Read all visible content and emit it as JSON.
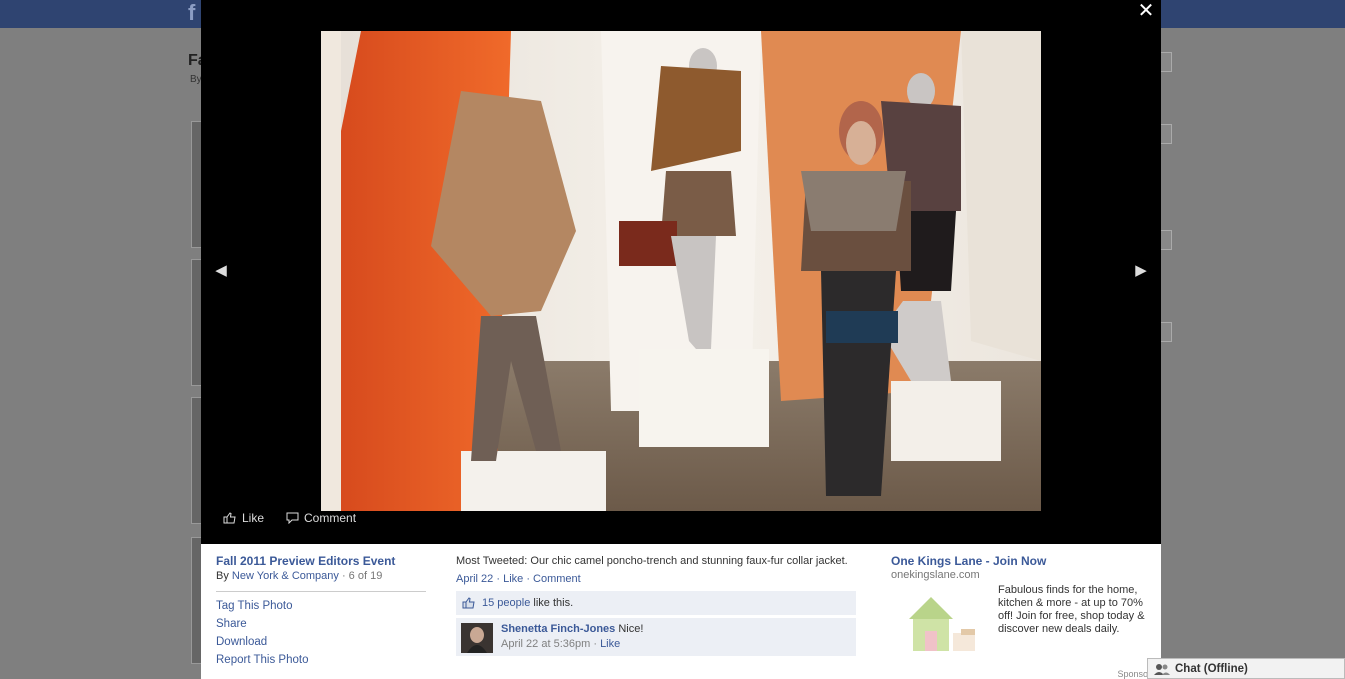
{
  "header": {
    "logo": "f"
  },
  "background": {
    "title": "Fa",
    "byline": "By"
  },
  "viewer": {
    "close_glyph": "✕",
    "prev_glyph": "◀",
    "next_glyph": "▶",
    "actions": {
      "like": "Like",
      "comment": "Comment"
    }
  },
  "info": {
    "album_title": "Fall 2011 Preview Editors Event",
    "by_label": "By",
    "owner": "New York & Company",
    "position": " · 6 of 19",
    "menu": [
      "Tag This Photo",
      "Share",
      "Download",
      "Report This Photo"
    ]
  },
  "caption": {
    "text": "Most Tweeted: Our chic camel poncho-trench and stunning faux-fur collar jacket.",
    "date": "April 22",
    "like": "Like",
    "comment": "Comment",
    "likes_count": "15 people",
    "likes_suffix": "like this."
  },
  "comment": {
    "author": "Shenetta Finch-Jones",
    "text": "Nice!",
    "meta": "April 22 at 5:36pm",
    "like": "Like"
  },
  "ad": {
    "title": "One Kings Lane - Join Now",
    "url": "onekingslane.com",
    "body": "Fabulous finds for the home, kitchen & more - at up to 70% off! Join for free, shop today & discover new deals daily.",
    "sponsored": "Sponsored"
  },
  "chat": {
    "label": "Chat (Offline)"
  },
  "colors": {
    "link": "#3b5998",
    "topbar": "#2f4471",
    "like_bg": "#eceff5"
  }
}
